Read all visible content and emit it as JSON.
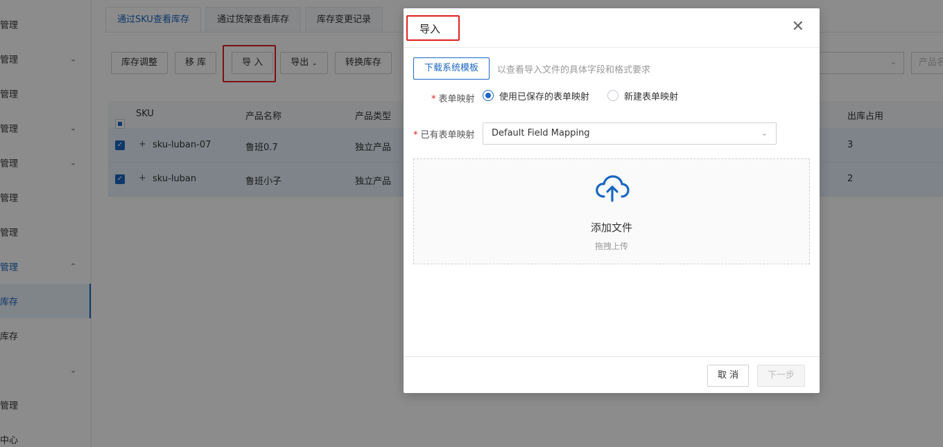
{
  "sidebar": {
    "items": [
      {
        "label": "管理"
      },
      {
        "label": "管理"
      },
      {
        "label": "管理"
      },
      {
        "label": "管理"
      },
      {
        "label": "管理"
      },
      {
        "label": "管理"
      },
      {
        "label": "管理"
      },
      {
        "label": "管理"
      },
      {
        "label": "库存"
      },
      {
        "label": "库存"
      },
      {
        "label": ""
      },
      {
        "label": "管理"
      },
      {
        "label": "中心"
      }
    ]
  },
  "tabs": [
    "通过SKU查看库存",
    "通过货架查看库存",
    "库存变更记录"
  ],
  "toolbar": {
    "adjust": "库存调整",
    "move": "移 库",
    "import": "导 入",
    "export": "导出",
    "convert": "转换库存"
  },
  "filters": {
    "product_placeholder": "产品名"
  },
  "table": {
    "headers": {
      "sku": "SKU",
      "name": "产品名称",
      "type": "产品类型",
      "outbound": "出库占用"
    },
    "rows": [
      {
        "sku": "sku-luban-07",
        "name": "鲁班0.7",
        "type": "独立产品",
        "outbound": "3"
      },
      {
        "sku": "sku-luban",
        "name": "鲁班小子",
        "type": "独立产品",
        "outbound": "2"
      }
    ]
  },
  "modal": {
    "title": "导入",
    "download_template": "下载系统模板",
    "download_hint": "以查看导入文件的具体字段和格式要求",
    "mapping_label": "表单映射",
    "radio_saved": "使用已保存的表单映射",
    "radio_new": "新建表单映射",
    "existing_label": "已有表单映射",
    "existing_value": "Default Field Mapping",
    "upload_title": "添加文件",
    "upload_sub": "拖拽上传",
    "cancel": "取 消",
    "next": "下一步"
  },
  "colors": {
    "accent": "#1a66c2",
    "highlight": "#e02020"
  }
}
